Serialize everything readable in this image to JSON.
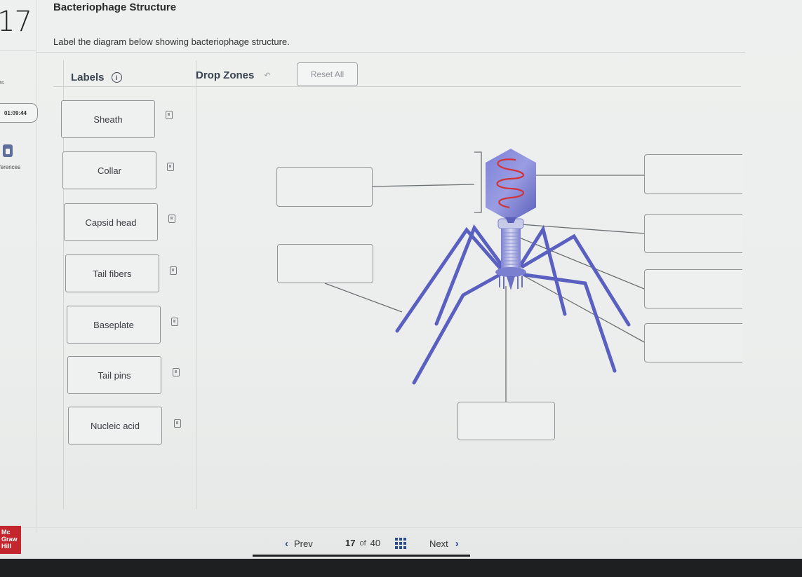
{
  "question": {
    "number": "17",
    "title": "Bacteriophage Structure",
    "instructions": "Label the diagram below showing bacteriophage structure."
  },
  "left_rail": {
    "partial_label": "ts",
    "timer": "01:09:44",
    "references_label": "eferences"
  },
  "panel": {
    "labels_heading": "Labels",
    "info_icon_glyph": "i",
    "drop_zones_heading": "Drop Zones",
    "undo_icon_glyph": "↶",
    "reset_button": "Reset All"
  },
  "labels": [
    {
      "text": "Sheath"
    },
    {
      "text": "Collar"
    },
    {
      "text": "Capsid head"
    },
    {
      "text": "Tail fibers"
    },
    {
      "text": "Baseplate"
    },
    {
      "text": "Tail pins"
    },
    {
      "text": "Nucleic acid"
    }
  ],
  "drop_zones": [
    {
      "id": "left-upper",
      "value": ""
    },
    {
      "id": "left-lower",
      "value": ""
    },
    {
      "id": "right-1",
      "value": ""
    },
    {
      "id": "right-2",
      "value": ""
    },
    {
      "id": "right-3",
      "value": ""
    },
    {
      "id": "right-4",
      "value": ""
    },
    {
      "id": "bottom",
      "value": ""
    }
  ],
  "colors": {
    "phage_body": "#6a6fc4",
    "nucleic_acid": "#d0343a",
    "brand_red": "#c4262e",
    "nav_accent": "#2a4b8d"
  },
  "footer": {
    "logo_text": [
      "Mc",
      "Graw",
      "Hill"
    ],
    "prev_label": "Prev",
    "current_page": "17",
    "of_label": "of",
    "total_pages": "40",
    "next_label": "Next"
  }
}
